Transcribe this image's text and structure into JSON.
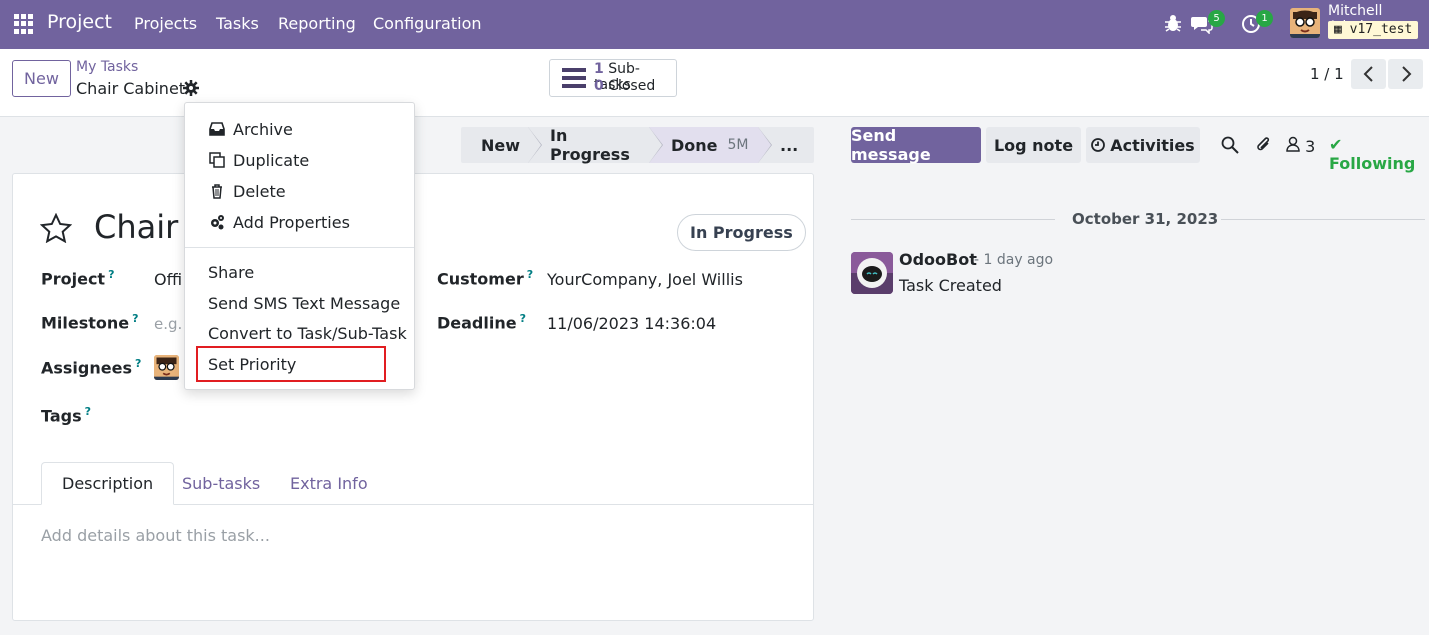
{
  "navbar": {
    "brand": "Project",
    "menu": [
      "Projects",
      "Tasks",
      "Reporting",
      "Configuration"
    ],
    "messages_count": "5",
    "activities_count": "1",
    "user_name": "Mitchell Admin",
    "database": "v17_test",
    "bg_color": "#71639e"
  },
  "control": {
    "new_label": "New",
    "breadcrumb_parent": "My Tasks",
    "breadcrumb_current": "Chair Cabinet",
    "subtasks_count": "1",
    "subtasks_label": "Sub-tasks",
    "closed_count": "0",
    "closed_label": "Closed",
    "pager": "1 / 1"
  },
  "statusbar": {
    "stages": [
      {
        "label": "New"
      },
      {
        "label": "In Progress"
      },
      {
        "label": "Done",
        "duration": "5M"
      },
      {
        "label": "..."
      }
    ]
  },
  "form": {
    "title": "Chair C",
    "state": "In Progress",
    "project_label": "Project",
    "project_value": "Offi",
    "milestone_label": "Milestone",
    "milestone_placeholder": "e.g.",
    "assignees_label": "Assignees",
    "tags_label": "Tags",
    "customer_label": "Customer",
    "customer_value": "YourCompany, Joel Willis",
    "deadline_label": "Deadline",
    "deadline_value": "11/06/2023 14:36:04",
    "help_mark": "?",
    "tabs": [
      "Description",
      "Sub-tasks",
      "Extra Info"
    ],
    "description_placeholder": "Add details about this task..."
  },
  "dropdown": {
    "actions": [
      {
        "label": "Archive",
        "icon": "archive-icon"
      },
      {
        "label": "Duplicate",
        "icon": "copy-icon"
      },
      {
        "label": "Delete",
        "icon": "trash-icon"
      },
      {
        "label": "Add Properties",
        "icon": "cogs-icon"
      }
    ],
    "more": [
      "Share",
      "Send SMS Text Message",
      "Convert to Task/Sub-Task",
      "Set Priority"
    ]
  },
  "chatter": {
    "send_message": "Send message",
    "log_note": "Log note",
    "activities": "Activities",
    "followers_count": "3",
    "following": "Following",
    "date": "October 31, 2023",
    "author": "OdooBot",
    "time": "- 1 day ago",
    "message": "Task Created"
  }
}
